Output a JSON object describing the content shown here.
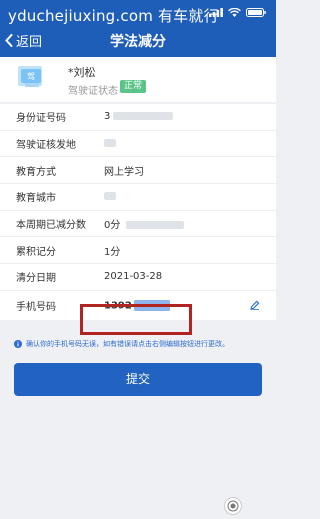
{
  "watermark": "yduchejiuxing.com 有车就行",
  "nav": {
    "back_label": "返回",
    "title": "学法减分"
  },
  "profile": {
    "avatar_badge": "驾",
    "name": "*刘松",
    "status_label": "驾驶证状态",
    "status_value": "正常",
    "status_color": "#5cc489"
  },
  "rows": [
    {
      "label": "身份证号码",
      "value": "3"
    },
    {
      "label": "驾驶证核发地",
      "value": ""
    },
    {
      "label": "教育方式",
      "value": "网上学习"
    },
    {
      "label": "教育城市",
      "value": ""
    },
    {
      "label": "本周期已减分数",
      "value": "0分"
    },
    {
      "label": "累积记分",
      "value": "1分"
    },
    {
      "label": "清分日期",
      "value": "2021-03-28"
    }
  ],
  "phone": {
    "label": "手机号码",
    "value": "1392"
  },
  "notice": "确认你的手机号码无误，如有错误请点击右侧编辑按钮进行更改。",
  "submit_label": "提交",
  "colors": {
    "header": "#1e5eb8",
    "accent": "#2262c0",
    "highlight_box": "#b02421"
  }
}
